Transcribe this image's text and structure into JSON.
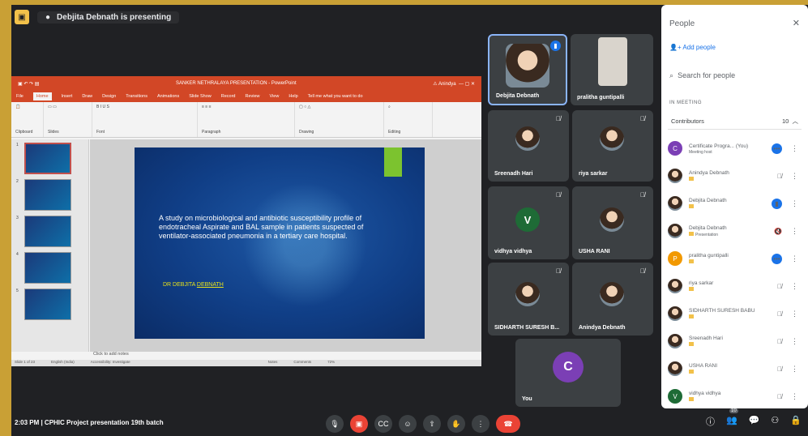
{
  "topbar": {
    "presenting": "Debjita Debnath is presenting"
  },
  "ppt": {
    "title": "SANKER NETHRALAYA PRESENTATION - PowerPoint",
    "user": "Anindya",
    "tabs": [
      "File",
      "Home",
      "Insert",
      "Draw",
      "Design",
      "Transitions",
      "Animations",
      "Slide Show",
      "Record",
      "Review",
      "View",
      "Help"
    ],
    "tell_me": "Tell me what you want to do",
    "ribbon_groups": [
      "Clipboard",
      "Slides",
      "Font",
      "Paragraph",
      "Drawing",
      "Editing"
    ],
    "slide_text": "A study on microbiological and antibiotic susceptibility profile of endotracheal Aspirate and BAL sample in patients suspected of ventilator-associated pneumonia in a tertiary care hospital.",
    "author_prefix": "DR DEBJITA",
    "author_underlined": "DEBNATH",
    "notes": "Click to add notes",
    "status_slide": "Slide 1 of 23",
    "status_lang": "English (India)",
    "status_access": "Accessibility: Investigate",
    "status_notes": "Notes",
    "status_comments": "Comments",
    "zoom": "72%",
    "thumb_numbers": [
      "1",
      "2",
      "3",
      "4",
      "5"
    ]
  },
  "tiles": [
    {
      "name": "Debjita Debnath"
    },
    {
      "name": "pralitha guntipalli"
    },
    {
      "name": "Sreenadh Hari"
    },
    {
      "name": "riya sarkar"
    },
    {
      "name": "vidhya vidhya",
      "initial": "V"
    },
    {
      "name": "USHA RANI"
    },
    {
      "name": "SIDHARTH SURESH B..."
    },
    {
      "name": "Anindya Debnath"
    },
    {
      "name": "You",
      "initial": "C"
    }
  ],
  "people": {
    "title": "People",
    "add": "Add people",
    "search_placeholder": "Search for people",
    "in_meeting": "IN MEETING",
    "contributors": "Contributors",
    "count": "10",
    "list": [
      {
        "name": "Certificate Progra...",
        "you": "(You)",
        "sub": "Meeting host",
        "initial": "C",
        "color": "#7b3fb5"
      },
      {
        "name": "Anindya Debnath",
        "sub": "",
        "initial": "",
        "color": "#6d7a80"
      },
      {
        "name": "Debjita Debnath",
        "sub": "",
        "initial": "",
        "color": "#6b4f3a"
      },
      {
        "name": "Debjita Debnath",
        "sub": "Presentation",
        "initial": "",
        "color": "#6b4f3a"
      },
      {
        "name": "pralitha guntipalli",
        "sub": "",
        "initial": "P",
        "color": "#f29900"
      },
      {
        "name": "riya sarkar",
        "sub": "",
        "initial": "",
        "color": "#4a3428"
      },
      {
        "name": "SIDHARTH SURESH BABU",
        "sub": "",
        "initial": "",
        "color": "#8a7a6a"
      },
      {
        "name": "Sreenadh Hari",
        "sub": "",
        "initial": "",
        "color": "#5a6a5a"
      },
      {
        "name": "USHA RANI",
        "sub": "",
        "initial": "",
        "color": "#9a7060"
      },
      {
        "name": "vidhya vidhya",
        "sub": "",
        "initial": "V",
        "color": "#1e6b36"
      }
    ]
  },
  "bottom": {
    "time_title": "2:03 PM  |  CPHIC Project presentation 19th batch",
    "people_count": "10"
  }
}
